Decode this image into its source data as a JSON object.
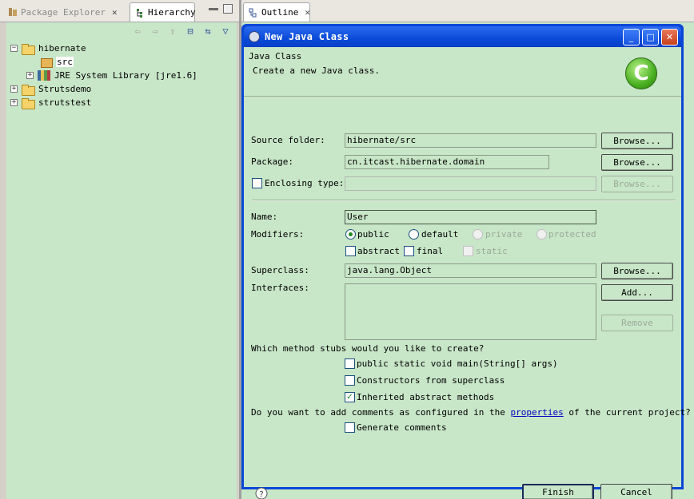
{
  "left_view": {
    "tabs": [
      {
        "label": "Package Explorer"
      },
      {
        "label": "Hierarchy"
      }
    ],
    "tree": [
      {
        "label": "hibernate",
        "expander": "−"
      },
      {
        "label": "src"
      },
      {
        "label": "JRE System Library [jre1.6]",
        "expander": "+"
      },
      {
        "label": "Strutsdemo",
        "expander": "+"
      },
      {
        "label": "strutstest",
        "expander": "+"
      }
    ]
  },
  "right_view": {
    "tabs": [
      {
        "label": "Outline"
      }
    ]
  },
  "dialog": {
    "title": "New Java Class",
    "banner": {
      "heading": "Java Class",
      "message": "Create a new Java class.",
      "logo_letter": "C"
    },
    "source_folder": {
      "label": "Source folder:",
      "value": "hibernate/src",
      "button": "Browse..."
    },
    "package": {
      "label": "Package:",
      "value": "cn.itcast.hibernate.domain",
      "button": "Browse..."
    },
    "enclosing_type": {
      "label": "Enclosing type:",
      "value": "",
      "button": "Browse..."
    },
    "name": {
      "label": "Name:",
      "value": "User"
    },
    "modifiers": {
      "label": "Modifiers:",
      "access": [
        "public",
        "default",
        "private",
        "protected"
      ],
      "selected": "public",
      "flags": [
        "abstract",
        "final",
        "static"
      ]
    },
    "superclass": {
      "label": "Superclass:",
      "value": "java.lang.Object",
      "button": "Browse..."
    },
    "interfaces": {
      "label": "Interfaces:",
      "add_button": "Add...",
      "remove_button": "Remove"
    },
    "stubs": {
      "question": "Which method stubs would you like to create?",
      "options": [
        {
          "label": "public static void main(String[] args)",
          "checked": false
        },
        {
          "label": "Constructors from superclass",
          "checked": false
        },
        {
          "label": "Inherited abstract methods",
          "checked": true
        }
      ]
    },
    "comments": {
      "question_prefix": "Do you want to add comments as configured in the",
      "link": "properties",
      "question_suffix": "of the current project?",
      "option": "Generate comments"
    },
    "footer": {
      "finish": "Finish",
      "cancel": "Cancel",
      "help_glyph": "?"
    }
  },
  "colors": {
    "background": "#c8e6c8",
    "title_bar": "#0a4ad8",
    "check": "#218a21"
  }
}
